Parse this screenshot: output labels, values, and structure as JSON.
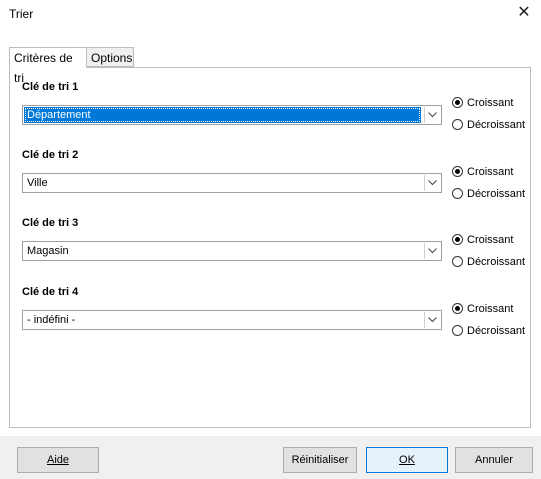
{
  "window": {
    "title": "Trier",
    "close_icon": "close-icon"
  },
  "tabs": [
    {
      "label": "Critères de tri",
      "active": true
    },
    {
      "label": "Options",
      "active": false
    }
  ],
  "sort_keys": [
    {
      "label": "Clé de tri 1",
      "value": "Département",
      "selected": true,
      "ascending": "Croissant",
      "descending": "Décroissant",
      "order": "ascending"
    },
    {
      "label": "Clé de tri 2",
      "value": "Ville",
      "selected": false,
      "ascending": "Croissant",
      "descending": "Décroissant",
      "order": "ascending"
    },
    {
      "label": "Clé de tri 3",
      "value": "Magasin",
      "selected": false,
      "ascending": "Croissant",
      "descending": "Décroissant",
      "order": "ascending"
    },
    {
      "label": "Clé de tri 4",
      "value": "- indéfini -",
      "selected": false,
      "ascending": "Croissant",
      "descending": "Décroissant",
      "order": "ascending"
    }
  ],
  "buttons": {
    "help": "Aide",
    "reset": "Réinitialiser",
    "ok": "OK",
    "cancel": "Annuler"
  },
  "colors": {
    "selection": "#0078d7",
    "default_button_border": "#0078d7"
  }
}
